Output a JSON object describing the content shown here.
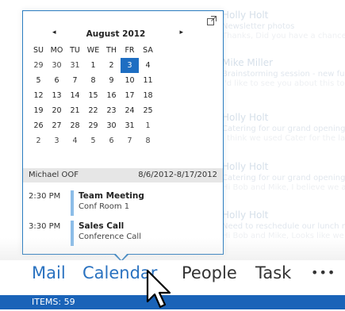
{
  "background_list": [
    {
      "from": "Holly Holt",
      "subject": "Newsletter photos",
      "preview": "Thanks, Did you have a chance to"
    },
    {
      "from": "Mike Miller",
      "subject": "Brainstorming session - new fur",
      "preview": "I'd like to see you about this topic"
    },
    {
      "from": "Holly Holt",
      "subject": "Catering for our grand opening",
      "preview": "I think we used Cater for the last"
    },
    {
      "from": "Holly Holt",
      "subject": "Catering for our grand opening",
      "preview": "Hi Bob and Mike, I believe we are"
    },
    {
      "from": "Holly Holt",
      "subject": "Need to reschedule our lunch m",
      "preview": "Hi Bob and Mike, Looks like we"
    }
  ],
  "calendar": {
    "prev_icon": "◂",
    "next_icon": "▸",
    "month_title": "August 2012",
    "weekdays": [
      "SU",
      "MO",
      "TU",
      "WE",
      "TH",
      "FR",
      "SA"
    ],
    "weeks": [
      [
        "29",
        "30",
        "31",
        "1",
        "2",
        "3",
        "4"
      ],
      [
        "5",
        "6",
        "7",
        "8",
        "9",
        "10",
        "11"
      ],
      [
        "12",
        "13",
        "14",
        "15",
        "16",
        "17",
        "18"
      ],
      [
        "19",
        "20",
        "21",
        "22",
        "23",
        "24",
        "25"
      ],
      [
        "26",
        "27",
        "28",
        "29",
        "30",
        "31",
        "1"
      ],
      [
        "2",
        "3",
        "4",
        "5",
        "6",
        "7",
        "8"
      ]
    ],
    "selected_date": "3"
  },
  "all_day_event": {
    "name": "Michael OOF",
    "dates": "8/6/2012-8/17/2012"
  },
  "appointments": [
    {
      "time": "2:30 PM",
      "title": "Team Meeting",
      "location": "Conf Room 1"
    },
    {
      "time": "3:30 PM",
      "title": "Sales Call",
      "location": "Conference Call"
    }
  ],
  "navigation": {
    "mail": "Mail",
    "calendar": "Calendar",
    "people": "People",
    "task": "Task",
    "more": "•••"
  },
  "status_bar": {
    "items": "ITEMS: 59"
  },
  "colors": {
    "accent": "#2a72c0",
    "status_bar": "#1a63b8",
    "selected_day": "#1e6ec2",
    "appointment_bar": "#8cbde8"
  }
}
